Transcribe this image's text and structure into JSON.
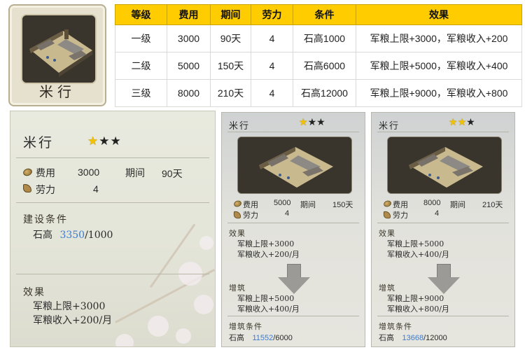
{
  "building": {
    "name": "米行"
  },
  "table": {
    "headers": [
      "等级",
      "费用",
      "期间",
      "劳力",
      "条件",
      "效果"
    ],
    "rows": [
      [
        "一级",
        "3000",
        "90天",
        "4",
        "石高1000",
        "军粮上限+3000，军粮收入+200"
      ],
      [
        "二级",
        "5000",
        "150天",
        "4",
        "石高6000",
        "军粮上限+5000，军粮收入+400"
      ],
      [
        "三级",
        "8000",
        "210天",
        "4",
        "石高12000",
        "军粮上限+9000，军粮收入+800"
      ]
    ]
  },
  "panel": {
    "title": "米行",
    "stars_filled": 1,
    "stars_total": 3,
    "cost_label": "费用",
    "cost": "3000",
    "period_label": "期间",
    "period": "90天",
    "labor_label": "劳力",
    "labor": "4",
    "cond_head": "建设条件",
    "cond_label": "石高",
    "cond_current": "3350",
    "cond_required": "/1000",
    "effect_head": "效果",
    "effects": [
      "军粮上限+3000",
      "军粮收入+200/月"
    ]
  },
  "cards": [
    {
      "title": "米行",
      "stars_filled": 1,
      "cost_label": "费用",
      "cost": "5000",
      "period_label": "期间",
      "period": "150天",
      "labor_label": "劳力",
      "labor": "4",
      "effect_head": "效果",
      "effects": [
        "军粮上限+3000",
        "军粮收入+200/月"
      ],
      "upgrade_head": "增筑",
      "upgrades": [
        "军粮上限+5000",
        "军粮收入+400/月"
      ],
      "cond_head": "增筑条件",
      "cond_label": "石高",
      "cond_current": "11552",
      "cond_required": "/6000"
    },
    {
      "title": "米行",
      "stars_filled": 2,
      "cost_label": "费用",
      "cost": "8000",
      "period_label": "期间",
      "period": "210天",
      "labor_label": "劳力",
      "labor": "4",
      "effect_head": "效果",
      "effects": [
        "军粮上限+5000",
        "军粮收入+400/月"
      ],
      "upgrade_head": "增筑",
      "upgrades": [
        "军粮上限+9000",
        "军粮收入+800/月"
      ],
      "cond_head": "增筑条件",
      "cond_label": "石高",
      "cond_current": "13668",
      "cond_required": "/12000"
    }
  ],
  "colors": {
    "header_bg": "#ffcc00",
    "highlight_blue": "#3a7bd5",
    "star_gold": "#f2c200"
  },
  "icons": {
    "cost": "rice-coin-icon",
    "labor": "arm-icon",
    "star": "star-icon",
    "arrow": "arrow-down-icon"
  }
}
